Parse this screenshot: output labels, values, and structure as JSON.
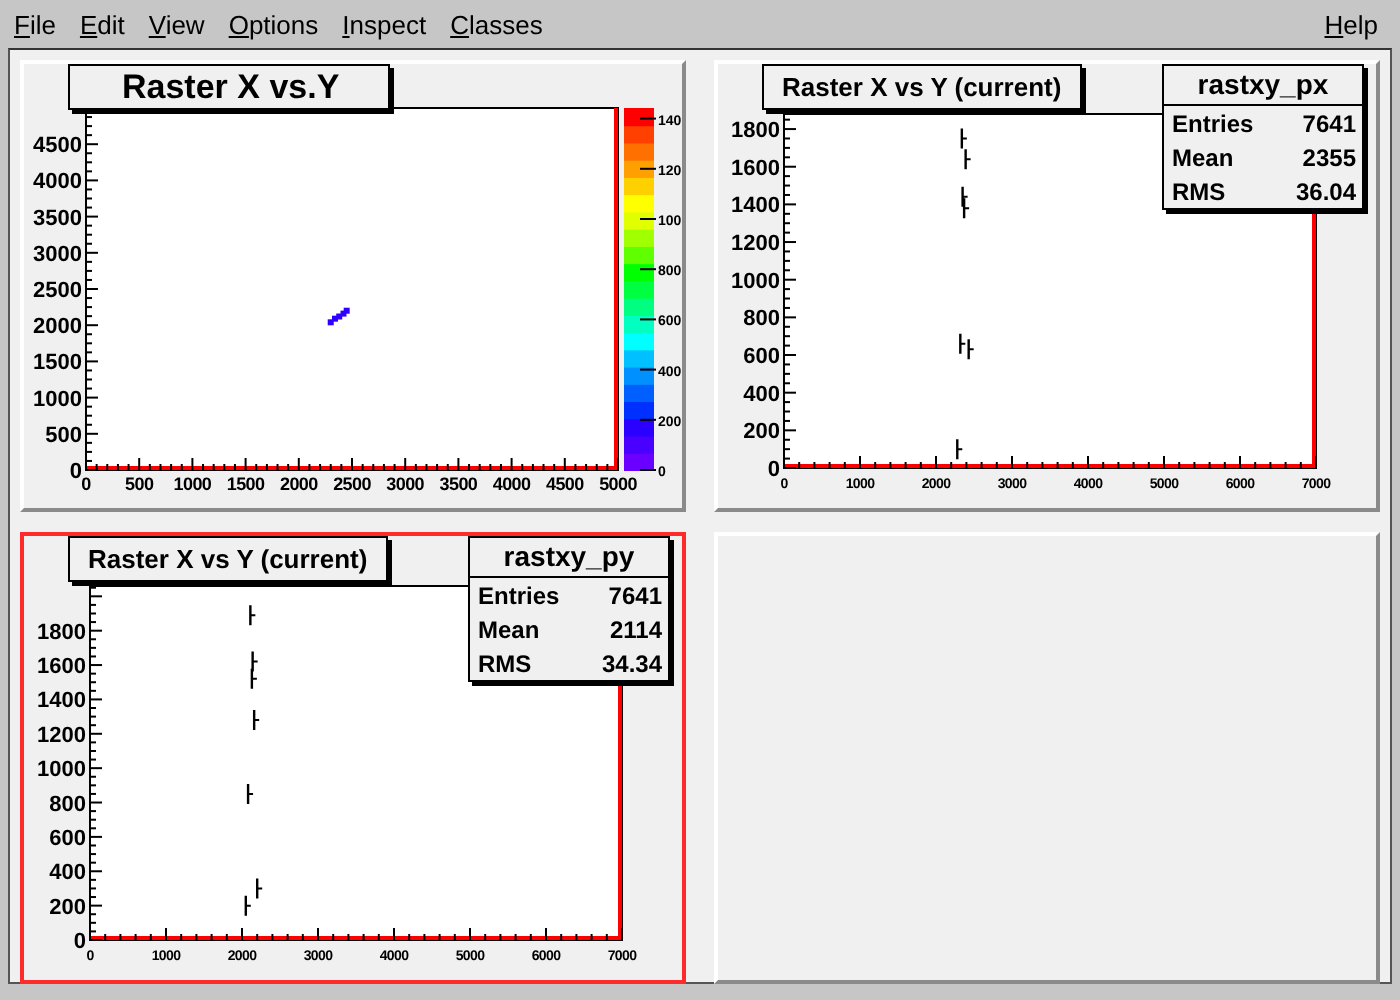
{
  "menu": [
    {
      "label": "File"
    },
    {
      "label": "Edit"
    },
    {
      "label": "View"
    },
    {
      "label": "Options"
    },
    {
      "label": "Inspect"
    },
    {
      "label": "Classes"
    }
  ],
  "help": {
    "label": "Help"
  },
  "pads": [
    {
      "kind": "hist2d",
      "selected": false,
      "title": "Raster X vs.Y",
      "palette_labels": [
        "140",
        "120",
        "100",
        "800",
        "600",
        "400",
        "200",
        "0"
      ],
      "chart_data": {
        "type": "scatter",
        "xlim": [
          0,
          5000
        ],
        "ylim": [
          0,
          5000
        ],
        "xticks": [
          0,
          500,
          1000,
          1500,
          2000,
          2500,
          3000,
          3500,
          4000,
          4500,
          5000
        ],
        "yticks": [
          0,
          500,
          1000,
          1500,
          2000,
          2500,
          3000,
          3500,
          4000,
          4500
        ],
        "x": [
          2300,
          2340,
          2380,
          2420,
          2450
        ],
        "series": [
          {
            "color": "#3000ff",
            "values": [
              2040,
              2090,
              2120,
              2160,
              2200
            ]
          }
        ]
      }
    },
    {
      "kind": "hist1d",
      "selected": false,
      "title": "Raster X vs Y (current)",
      "stats": {
        "name": "rastxy_px",
        "rows": [
          {
            "label": "Entries",
            "value": "7641"
          },
          {
            "label": "Mean",
            "value": "2355"
          },
          {
            "label": "RMS",
            "value": "36.04"
          }
        ]
      },
      "chart_data": {
        "type": "scatter",
        "xlim": [
          0,
          7000
        ],
        "ylim": [
          0,
          1880
        ],
        "xticks": [
          0,
          1000,
          2000,
          3000,
          4000,
          5000,
          6000,
          7000
        ],
        "yticks": [
          0,
          200,
          400,
          600,
          800,
          1000,
          1200,
          1400,
          1600,
          1800
        ],
        "x": [
          2340,
          2390,
          2350,
          2370,
          2320,
          2430,
          2280
        ],
        "series": [
          {
            "color": "#000000",
            "values": [
              1750,
              1640,
              1440,
              1380,
              660,
              630,
              100
            ]
          }
        ]
      }
    },
    {
      "kind": "hist1d",
      "selected": true,
      "title": "Raster X vs Y (current)",
      "stats": {
        "name": "rastxy_py",
        "rows": [
          {
            "label": "Entries",
            "value": "7641"
          },
          {
            "label": "Mean",
            "value": "2114"
          },
          {
            "label": "RMS",
            "value": "34.34"
          }
        ]
      },
      "chart_data": {
        "type": "scatter",
        "xlim": [
          0,
          7000
        ],
        "ylim": [
          0,
          2060
        ],
        "xticks": [
          0,
          1000,
          2000,
          3000,
          4000,
          5000,
          6000,
          7000
        ],
        "yticks": [
          0,
          200,
          400,
          600,
          800,
          1000,
          1200,
          1400,
          1600,
          1800
        ],
        "x": [
          2110,
          2140,
          2130,
          2160,
          2080,
          2200,
          2050
        ],
        "series": [
          {
            "color": "#000000",
            "values": [
              1890,
              1620,
              1520,
              1280,
              850,
              300,
              200
            ]
          }
        ]
      }
    },
    {
      "kind": "empty",
      "selected": false
    }
  ]
}
